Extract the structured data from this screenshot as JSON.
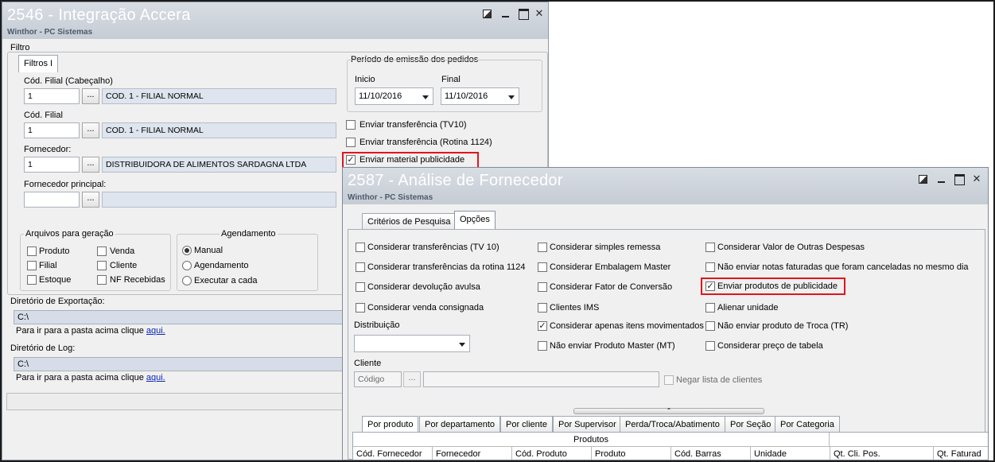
{
  "win1": {
    "title": "2546 - Integração Accera",
    "subtitle": "Winthor - PC Sistemas",
    "filtro_label": "Filtro",
    "tab": "Filtros I",
    "cod_filial_cab": {
      "label": "Cód. Filial (Cabeçalho)",
      "value": "1",
      "desc": "COD. 1 - FILIAL NORMAL"
    },
    "cod_filial": {
      "label": "Cód. Filial",
      "value": "1",
      "desc": "COD. 1 - FILIAL NORMAL"
    },
    "fornecedor": {
      "label": "Fornecedor:",
      "value": "1",
      "desc": "DISTRIBUIDORA DE ALIMENTOS SARDAGNA LTDA"
    },
    "fornecedor_principal": {
      "label": "Fornecedor principal:",
      "value": "",
      "desc": ""
    },
    "dots": "...",
    "periodo": {
      "label": "Período de emissão dos pedidos",
      "inicio_label": "Inicio",
      "inicio": "11/10/2016",
      "final_label": "Final",
      "final": "11/10/2016"
    },
    "checks": [
      {
        "label": "Enviar transferência (TV10)",
        "checked": false
      },
      {
        "label": "Enviar transferência (Rotina 1124)",
        "checked": false
      },
      {
        "label": "Enviar material publicidade",
        "checked": true
      }
    ],
    "arquivos": {
      "title": "Arquivos para geração",
      "items": [
        "Produto",
        "Venda",
        "Filial",
        "Cliente",
        "Estoque",
        "NF Recebidas"
      ]
    },
    "agendamento": {
      "title": "Agendamento",
      "options": [
        "Manual",
        "Agendamento",
        "Executar a cada"
      ]
    },
    "dir_export": {
      "label": "Diretório de Exportação:",
      "value": "C:\\",
      "hint": "Para ir para a pasta acima clique",
      "link": "aqui."
    },
    "dir_log": {
      "label": "Diretório de Log:",
      "value": "C:\\",
      "hint": "Para ir para a pasta acima clique",
      "link": "aqui."
    }
  },
  "win2": {
    "title": "2587 - Análise de Fornecedor",
    "subtitle": "Winthor - PC Sistemas",
    "tabs": [
      "Critérios de Pesquisa",
      "Opções"
    ],
    "col1": [
      {
        "label": "Considerar transferências (TV 10)",
        "checked": false
      },
      {
        "label": "Considerar transferências da rotina 1124",
        "checked": false
      },
      {
        "label": "Considerar devolução avulsa",
        "checked": false
      },
      {
        "label": "Considerar venda consignada",
        "checked": false
      }
    ],
    "col2": [
      {
        "label": "Considerar simples remessa",
        "checked": false
      },
      {
        "label": "Considerar Embalagem Master",
        "checked": false
      },
      {
        "label": "Considerar Fator de Conversão",
        "checked": false
      },
      {
        "label": "Clientes IMS",
        "checked": false
      },
      {
        "label": "Considerar apenas itens movimentados",
        "checked": true
      },
      {
        "label": "Não enviar Produto Master (MT)",
        "checked": false
      }
    ],
    "col3": [
      {
        "label": "Considerar Valor de Outras Despesas",
        "checked": false
      },
      {
        "label": "Não enviar notas faturadas que foram canceladas no mesmo dia",
        "checked": false
      },
      {
        "label": "Enviar produtos de publicidade",
        "checked": true
      },
      {
        "label": "Alienar unidade",
        "checked": false
      },
      {
        "label": "Não enviar produto de Troca (TR)",
        "checked": false
      },
      {
        "label": "Considerar preço de tabela",
        "checked": false
      }
    ],
    "distribuicao_label": "Distribuição",
    "cliente_label": "Cliente",
    "codigo_placeholder": "Código",
    "dots": "...",
    "negar_label": "Negar lista de clientes",
    "bottom_tabs": [
      "Por produto",
      "Por departamento",
      "Por cliente",
      "Por Supervisor",
      "Perda/Troca/Abatimento",
      "Por Seção",
      "Por Categoria"
    ],
    "grid_group": "Produtos",
    "grid_columns": [
      "Cód. Fornecedor",
      "Fornecedor",
      "Cód. Produto",
      "Produto",
      "Cód. Barras",
      "Unidade",
      "Qt. Cli. Pos.",
      "Qt. Faturad"
    ]
  }
}
